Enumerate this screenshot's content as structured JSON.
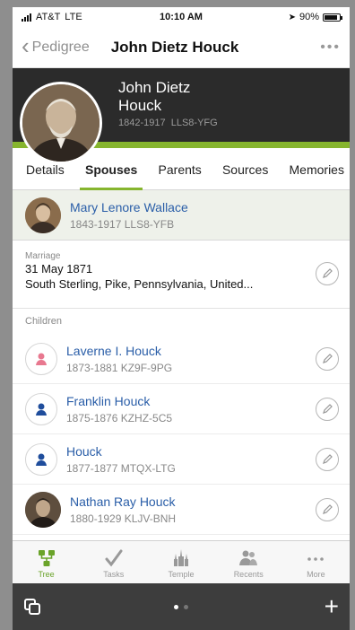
{
  "status_bar": {
    "carrier": "AT&T",
    "network": "LTE",
    "time": "10:10 AM",
    "battery": "90%",
    "battery_level": 0.9
  },
  "navbar": {
    "back_label": "Pedigree",
    "title": "John Dietz Houck",
    "more": "•••"
  },
  "person": {
    "name": "John Dietz Houck",
    "dates": "1842-1917",
    "id": "LLS8-YFG"
  },
  "tabs": [
    {
      "label": "Details"
    },
    {
      "label": "Spouses",
      "active": true
    },
    {
      "label": "Parents"
    },
    {
      "label": "Sources"
    },
    {
      "label": "Memories"
    }
  ],
  "spouse": {
    "name": "Mary Lenore Wallace",
    "meta": "1843-1917   LLS8-YFB"
  },
  "marriage": {
    "label": "Marriage",
    "date": "31 May 1871",
    "place": "South Sterling, Pike, Pennsylvania, United..."
  },
  "children": {
    "label": "Children",
    "items": [
      {
        "name": "Laverne I. Houck",
        "meta": "1873-1881   KZ9F-9PG",
        "gender": "female"
      },
      {
        "name": "Franklin Houck",
        "meta": "1875-1876   KZHZ-5C5",
        "gender": "male"
      },
      {
        "name": "Houck",
        "meta": "1877-1877   MTQX-LTG",
        "gender": "male"
      },
      {
        "name": "Nathan Ray Houck",
        "meta": "1880-1929   KLJV-BNH",
        "gender": "photo"
      }
    ]
  },
  "tabbar": [
    {
      "label": "Tree",
      "icon": "tree-icon",
      "active": true
    },
    {
      "label": "Tasks",
      "icon": "check-icon"
    },
    {
      "label": "Temple",
      "icon": "temple-icon"
    },
    {
      "label": "Recents",
      "icon": "people-icon"
    },
    {
      "label": "More",
      "icon": "more-icon"
    }
  ],
  "browser_bar": {
    "plus": "+"
  },
  "colors": {
    "green": "#86b52e",
    "link": "#2a5ea8",
    "female": "#e8788f",
    "male": "#1f4d9c"
  }
}
